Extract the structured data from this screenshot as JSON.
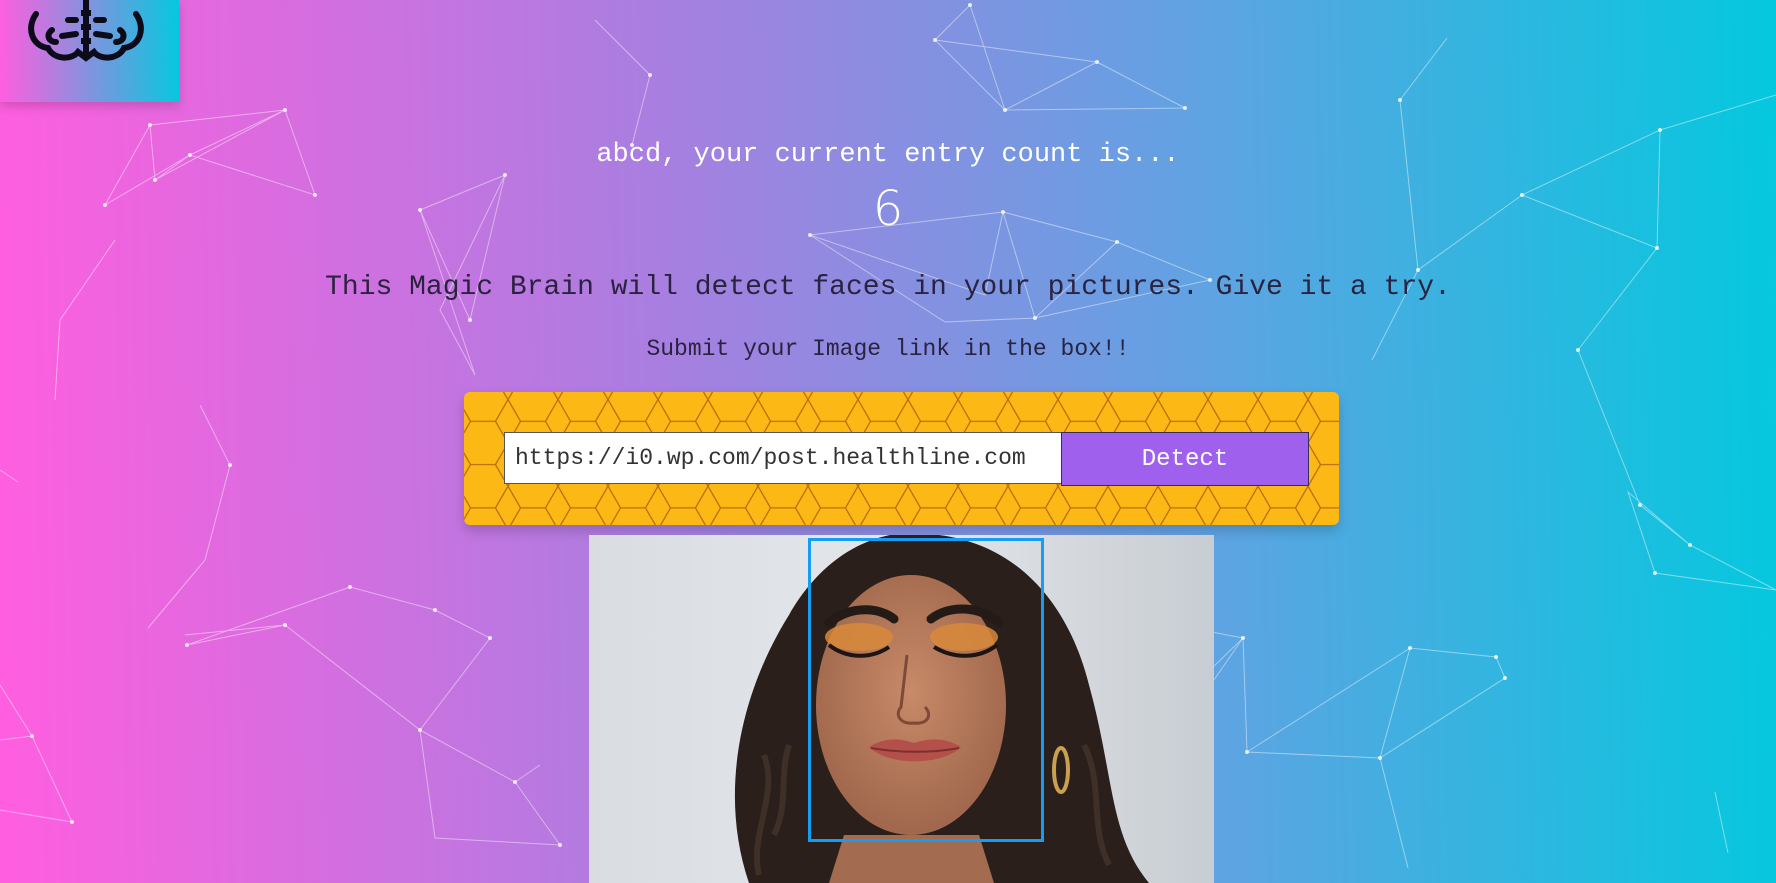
{
  "greeting": "abcd, your current entry count is...",
  "entry_count": "6",
  "intro": "This Magic Brain will detect faces in your pictures. Give it a try.",
  "submit_prompt": "Submit your Image link in the box!!",
  "form": {
    "url_value": "https://i0.wp.com/post.healthline.com",
    "detect_label": "Detect"
  },
  "colors": {
    "gradient_left": "#ff5edf",
    "gradient_right": "#04c8de",
    "panel": "#fcb814",
    "button": "#a060ee",
    "face_box": "#149df2"
  },
  "icons": {
    "logo": "brain-icon"
  }
}
